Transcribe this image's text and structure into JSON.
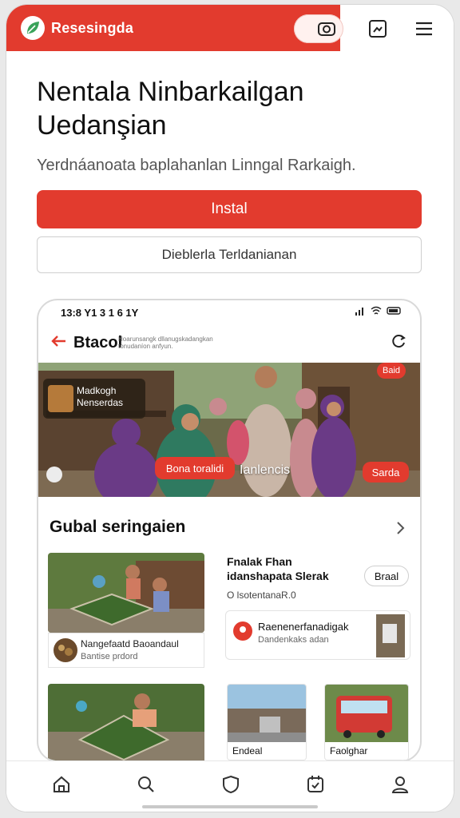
{
  "header": {
    "brand": "Resesingda",
    "accent": "#e23b2e"
  },
  "hero": {
    "title_line1": "Nentala Ninbarkailgan",
    "title_line2": "Uedanşian",
    "subtitle": "Yerdnáanoata baplahanlan Linngal Rarkaigh.",
    "install_label": "Instal",
    "secondary_label": "Dieblerla Terldanianan"
  },
  "phone": {
    "status_time": "13:8 Y1 3 1 6 1Y",
    "app_title": "Btacol",
    "app_meta": "Hoarunsangk dllanugskadangkan tonudaníon anfyun.",
    "banner_card_line1": "Madkogh",
    "banner_card_line2": "Nenserdas",
    "banner_chip_top": "Baid",
    "banner_chip_center": "Bona toralidi",
    "banner_text": "Ianlencis",
    "banner_chip_right": "Sarda",
    "section_title": "Gubal seringaien",
    "card1_title": "Nangefaatd Baoandaul",
    "card1_sub": "Bantise prdord",
    "right_title": "Fnalak Fhan idanshapata Slerak",
    "right_sub": "O lsotentanaR.0",
    "right_button": "Braal",
    "info_title": "Raenenerfanadigak",
    "info_sub": "Dandenkaks adan",
    "tile2_label": "Endeal",
    "tile3_label": "Faolghar"
  },
  "nav": {
    "items": [
      "home-icon",
      "search-icon",
      "shield-icon",
      "calendar-icon",
      "profile-icon"
    ]
  }
}
